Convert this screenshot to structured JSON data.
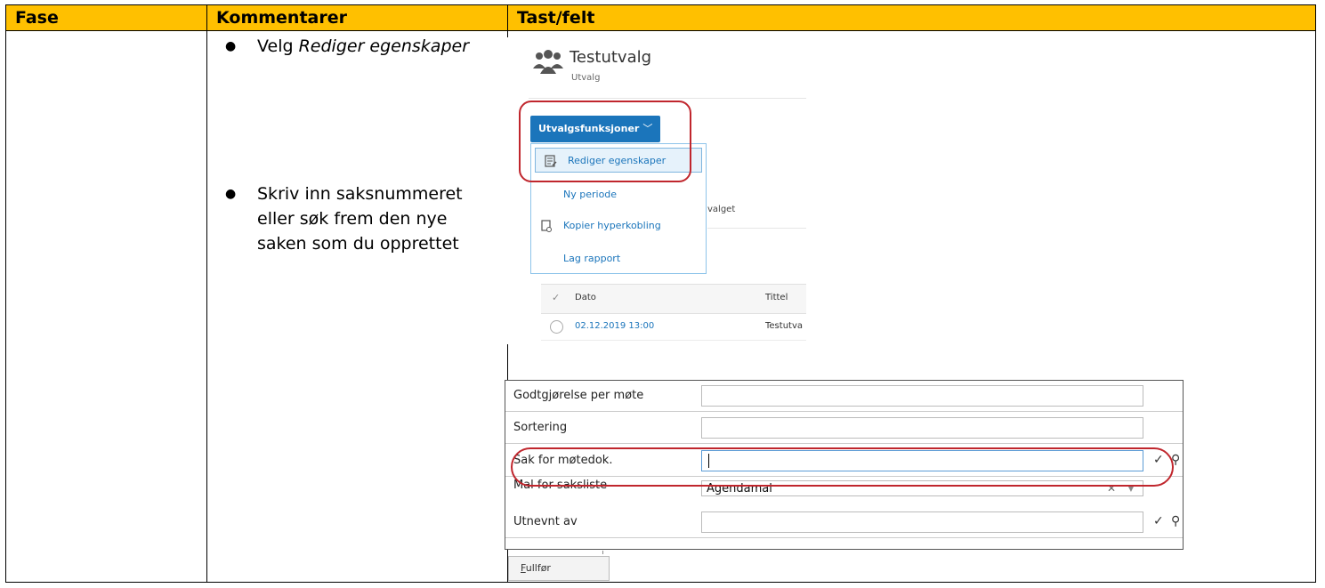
{
  "table": {
    "headers": [
      "Fase",
      "Kommentarer",
      "Tast/felt"
    ],
    "comments": [
      {
        "prefix": "Velg ",
        "emph": "Rediger egenskaper"
      },
      {
        "text": "Skriv inn saksnummeret eller søk frem den nye saken som du opprettet"
      }
    ]
  },
  "shot1": {
    "title": "Testutvalg",
    "subtitle": "Utvalg",
    "menu_button": "Utvalgsfunksjoner",
    "menu_items": [
      "Rediger egenskaper",
      "Ny periode",
      "Kopier hyperkobling",
      "Lag rapport"
    ],
    "behind_text": "valget",
    "grid": {
      "columns": [
        "Dato",
        "Tittel"
      ],
      "row": {
        "date": "02.12.2019 13:00",
        "title": "Testutva"
      }
    }
  },
  "shot2": {
    "rows": [
      {
        "label": "Godtgjørelse per møte"
      },
      {
        "label": "Sortering"
      },
      {
        "label": "Sak for møtedok."
      },
      {
        "label": "Mal for saksliste",
        "value": "Agendamal"
      },
      {
        "label": "Utnevnt av"
      }
    ],
    "finish_button": {
      "accesskey": "F",
      "rest": "ullfør"
    }
  },
  "colors": {
    "header_bg": "#ffc000",
    "accent_blue": "#1b75bb",
    "highlight_red": "#c0262d"
  }
}
